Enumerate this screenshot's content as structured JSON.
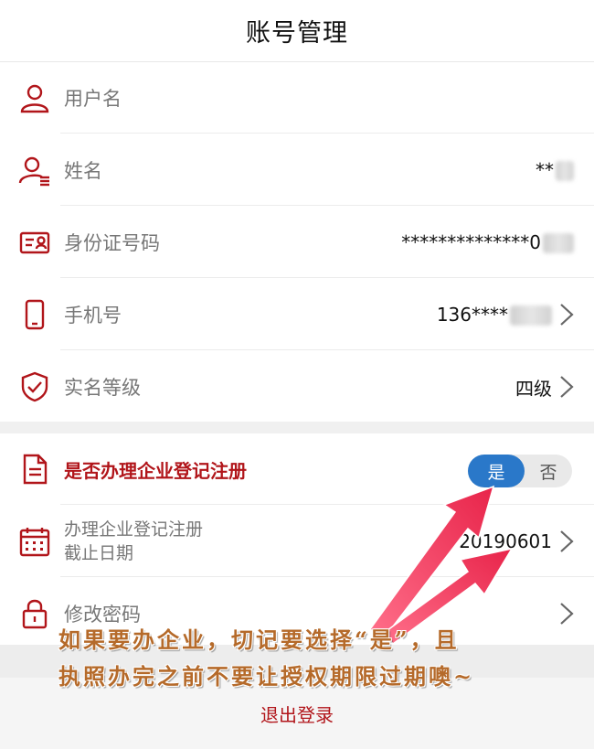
{
  "header": {
    "title": "账号管理"
  },
  "rows": {
    "username": {
      "label": "用户名",
      "value": ""
    },
    "name": {
      "label": "姓名",
      "value": "**"
    },
    "id_number": {
      "label": "身份证号码",
      "value": "**************0"
    },
    "phone": {
      "label": "手机号",
      "value": "136****"
    },
    "verify_level": {
      "label": "实名等级",
      "value": "四级"
    },
    "enterprise_reg": {
      "label": "是否办理企业登记注册"
    },
    "deadline": {
      "label_line1": "办理企业登记注册",
      "label_line2": "截止日期",
      "value": "20190601"
    },
    "password": {
      "label": "修改密码"
    }
  },
  "toggle": {
    "yes": "是",
    "no": "否",
    "selected": "是"
  },
  "logout": {
    "label": "退出登录"
  },
  "annotation": {
    "line1": "如果要办企业，切记要选择“是”，且",
    "line2": "执照办完之前不要让授权期限过期噢~"
  },
  "colors": {
    "accent_red": "#b1151a",
    "toggle_blue": "#2a78c9",
    "arrow_red": "#e8244a"
  }
}
